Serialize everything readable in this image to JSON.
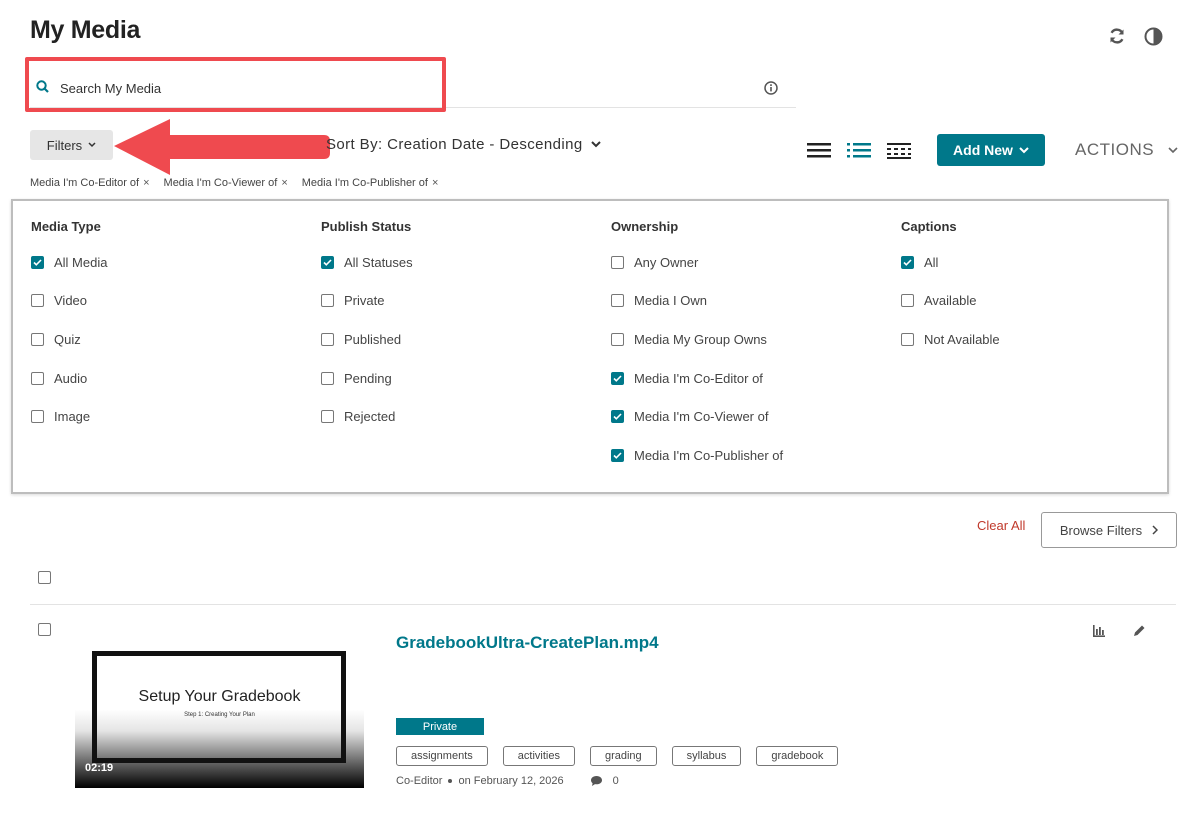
{
  "page": {
    "title": "My Media"
  },
  "search": {
    "placeholder": "Search My Media"
  },
  "toolbar": {
    "filters_label": "Filters",
    "sort_label": "Sort By: Creation Date - Descending",
    "add_new_label": "Add New",
    "actions_label": "ACTIONS"
  },
  "active_filters": [
    {
      "label": "Media I'm Co-Editor of",
      "remove": "×"
    },
    {
      "label": "Media I'm Co-Viewer of",
      "remove": "×"
    },
    {
      "label": "Media I'm Co-Publisher of",
      "remove": "×"
    }
  ],
  "filter_panel": {
    "columns": [
      {
        "heading": "Media Type",
        "options": [
          {
            "label": "All Media",
            "checked": true
          },
          {
            "label": "Video",
            "checked": false
          },
          {
            "label": "Quiz",
            "checked": false
          },
          {
            "label": "Audio",
            "checked": false
          },
          {
            "label": "Image",
            "checked": false
          }
        ]
      },
      {
        "heading": "Publish Status",
        "options": [
          {
            "label": "All Statuses",
            "checked": true
          },
          {
            "label": "Private",
            "checked": false
          },
          {
            "label": "Published",
            "checked": false
          },
          {
            "label": "Pending",
            "checked": false
          },
          {
            "label": "Rejected",
            "checked": false
          }
        ]
      },
      {
        "heading": "Ownership",
        "options": [
          {
            "label": "Any Owner",
            "checked": false
          },
          {
            "label": "Media I Own",
            "checked": false
          },
          {
            "label": "Media My Group Owns",
            "checked": false
          },
          {
            "label": "Media I'm Co-Editor of",
            "checked": true
          },
          {
            "label": "Media I'm Co-Viewer of",
            "checked": true
          },
          {
            "label": "Media I'm Co-Publisher of",
            "checked": true
          }
        ]
      },
      {
        "heading": "Captions",
        "options": [
          {
            "label": "All",
            "checked": true
          },
          {
            "label": "Available",
            "checked": false
          },
          {
            "label": "Not Available",
            "checked": false
          }
        ]
      }
    ],
    "clear_all_label": "Clear All",
    "browse_filters_label": "Browse Filters"
  },
  "entry": {
    "title": "GradebookUltra-CreatePlan.mp4",
    "thumbnail_title": "Setup Your Gradebook",
    "thumbnail_subtitle": "Step 1: Creating Your Plan",
    "duration": "02:19",
    "status": "Private",
    "tags": [
      "assignments",
      "activities",
      "grading",
      "syllabus",
      "gradebook"
    ],
    "role": "Co-Editor",
    "date": "on February 12, 2026",
    "comments": "0"
  },
  "icons": {
    "refresh": "refresh-icon",
    "contrast": "contrast-icon",
    "search": "search-icon",
    "info": "info-icon",
    "analytics": "analytics-icon",
    "edit": "pencil-icon",
    "comment": "comment-icon"
  },
  "colors": {
    "accent": "#00788a",
    "clear_all": "#c0392b",
    "annotation": "#ef4a4f"
  }
}
